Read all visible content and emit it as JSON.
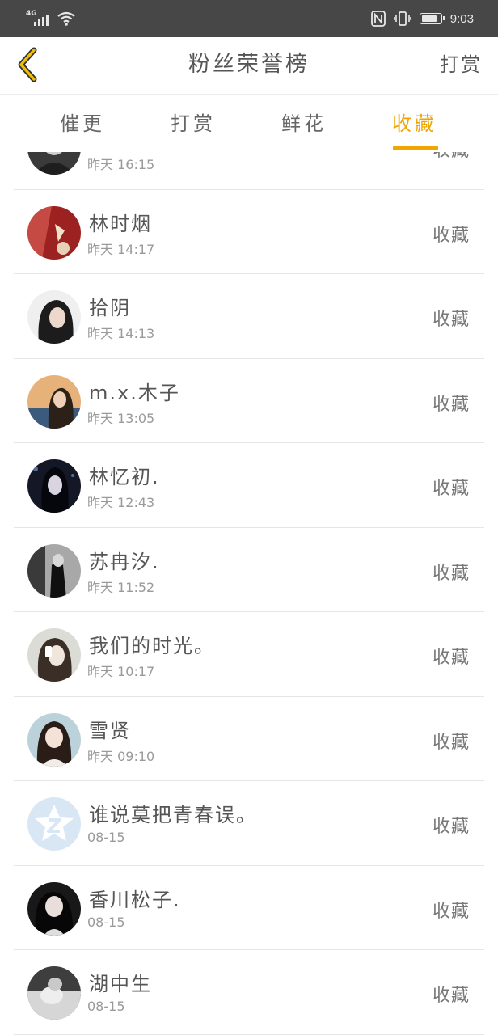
{
  "status_bar": {
    "network": "4G",
    "time": "9:03",
    "battery_level": 0.85
  },
  "nav": {
    "title": "粉丝荣誉榜",
    "right_action": "打赏"
  },
  "tabs": [
    {
      "label": "催更",
      "active": false
    },
    {
      "label": "打赏",
      "active": false
    },
    {
      "label": "鲜花",
      "active": false
    },
    {
      "label": "收藏",
      "active": true
    }
  ],
  "rows": [
    {
      "name": "",
      "time": "昨天  16:15",
      "action": "收藏"
    },
    {
      "name": "林时烟",
      "time": "昨天  14:17",
      "action": "收藏"
    },
    {
      "name": "拾阴",
      "time": "昨天  14:13",
      "action": "收藏"
    },
    {
      "name": "m.x.木子",
      "time": "昨天  13:05",
      "action": "收藏"
    },
    {
      "name": "林忆初.",
      "time": "昨天  12:43",
      "action": "收藏"
    },
    {
      "name": "苏冉汐.",
      "time": "昨天  11:52",
      "action": "收藏"
    },
    {
      "name": "我们的时光。",
      "time": "昨天  10:17",
      "action": "收藏"
    },
    {
      "name": "雪贤",
      "time": "昨天  09:10",
      "action": "收藏"
    },
    {
      "name": "谁说莫把青春误。",
      "time": "08-15",
      "action": "收藏"
    },
    {
      "name": "香川松子.",
      "time": "08-15",
      "action": "收藏"
    },
    {
      "name": "湖中生",
      "time": "08-15",
      "action": "收藏"
    }
  ],
  "colors": {
    "accent": "#f0a500",
    "status_bar_bg": "#474747",
    "divider": "#e6e6e6"
  }
}
